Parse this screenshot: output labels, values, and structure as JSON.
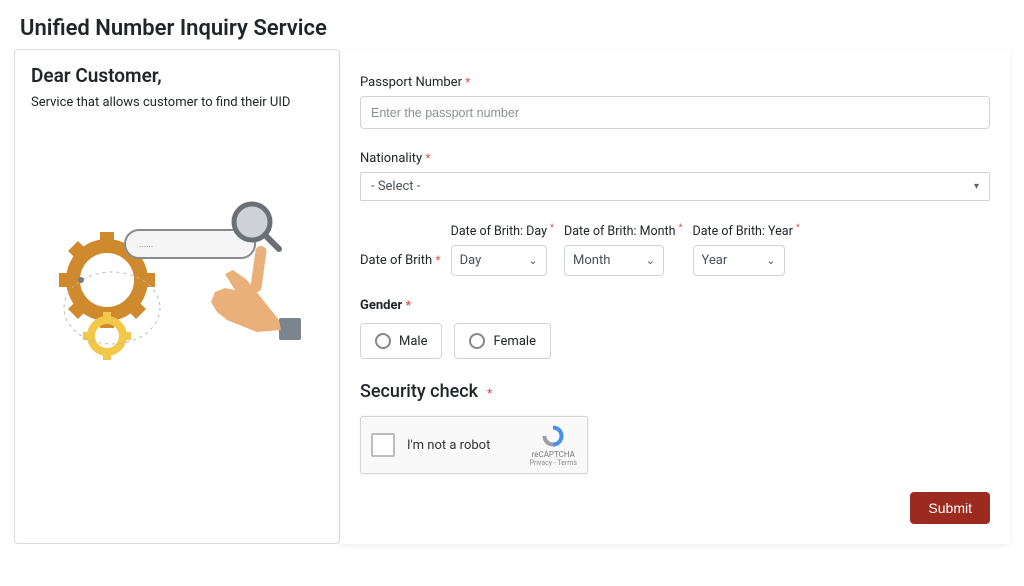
{
  "page": {
    "title": "Unified Number Inquiry Service"
  },
  "left": {
    "greeting": "Dear Customer,",
    "description": "Service that allows customer to find their UID"
  },
  "form": {
    "passport": {
      "label": "Passport Number",
      "placeholder": "Enter the passport number",
      "value": ""
    },
    "nationality": {
      "label": "Nationality",
      "selected": "- Select -"
    },
    "dob": {
      "main_label": "Date of Brith",
      "day": {
        "label": "Date of Brith: Day",
        "value": "Day"
      },
      "month": {
        "label": "Date of Brith: Month",
        "value": "Month"
      },
      "year": {
        "label": "Date of Brith: Year",
        "value": "Year"
      }
    },
    "gender": {
      "label": "Gender",
      "options": {
        "male": "Male",
        "female": "Female"
      }
    },
    "security": {
      "title": "Security check",
      "recaptcha_label": "I'm not a robot",
      "brand": "reCAPTCHA",
      "terms": "Privacy - Terms"
    },
    "submit": "Submit"
  },
  "star": "*"
}
